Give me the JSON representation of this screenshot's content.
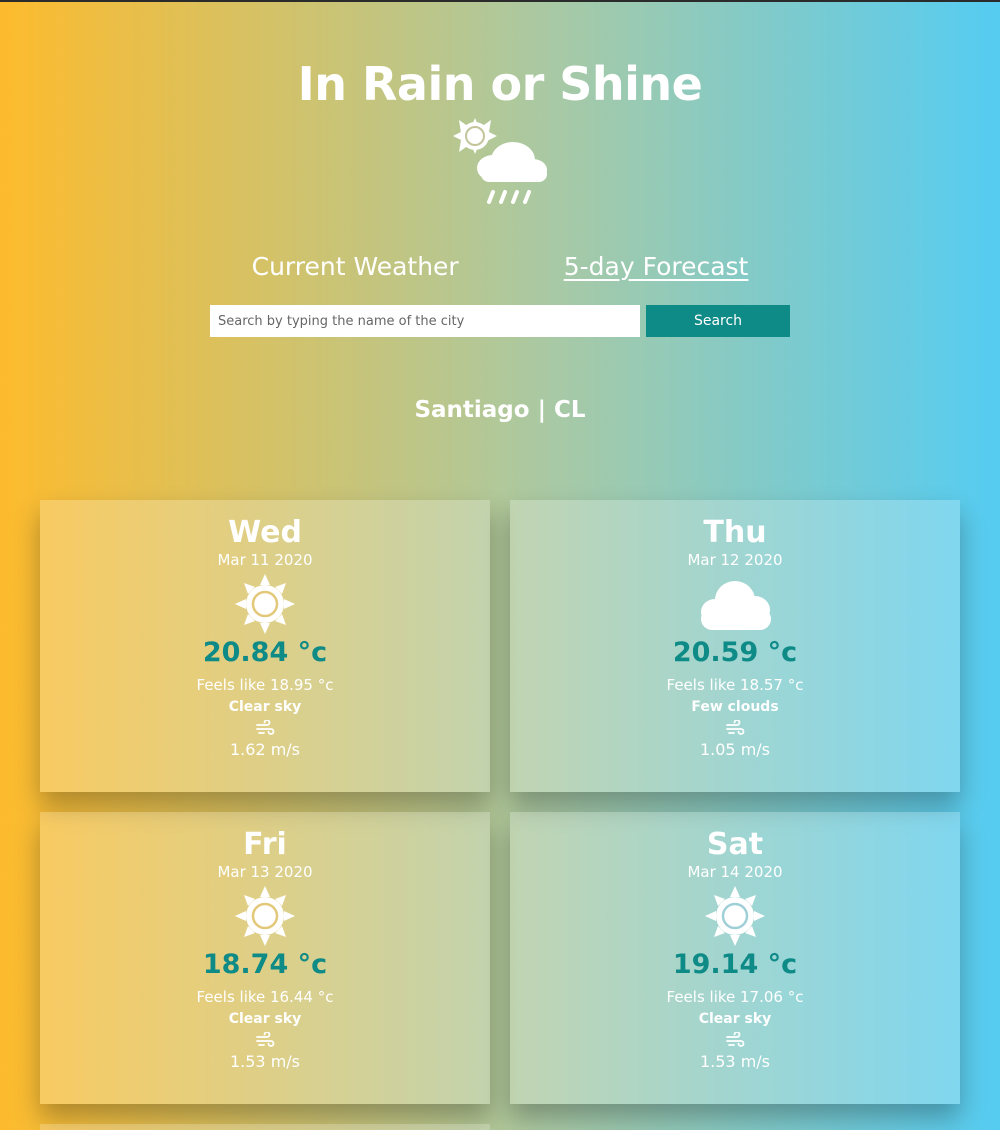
{
  "app": {
    "title": "In Rain or Shine",
    "logo_icon": "sun-cloud-rain-icon"
  },
  "nav": {
    "tabs": [
      {
        "label": "Current Weather",
        "active": false
      },
      {
        "label": "5-day Forecast",
        "active": true
      }
    ]
  },
  "search": {
    "placeholder": "Search by typing the name of the city",
    "value": "",
    "button_label": "Search"
  },
  "location": {
    "label": "Santiago | CL"
  },
  "forecast": [
    {
      "day": "Wed",
      "date": "Mar 11 2020",
      "icon": "sun-icon",
      "temp": "20.84 °c",
      "feels": "Feels like 18.95 °c",
      "desc": "Clear sky",
      "wind_icon": "wind-icon",
      "wind": "1.62 m/s"
    },
    {
      "day": "Thu",
      "date": "Mar 12 2020",
      "icon": "cloud-icon",
      "temp": "20.59 °c",
      "feels": "Feels like 18.57 °c",
      "desc": "Few clouds",
      "wind_icon": "wind-icon",
      "wind": "1.05 m/s"
    },
    {
      "day": "Fri",
      "date": "Mar 13 2020",
      "icon": "sun-icon",
      "temp": "18.74 °c",
      "feels": "Feels like 16.44 °c",
      "desc": "Clear sky",
      "wind_icon": "wind-icon",
      "wind": "1.53 m/s"
    },
    {
      "day": "Sat",
      "date": "Mar 14 2020",
      "icon": "sun-icon",
      "temp": "19.14 °c",
      "feels": "Feels like 17.06 °c",
      "desc": "Clear sky",
      "wind_icon": "wind-icon",
      "wind": "1.53 m/s"
    }
  ],
  "colors": {
    "gradient_left": "#FDBB2D",
    "gradient_right": "#55CCF2",
    "accent": "#0E8A87"
  }
}
